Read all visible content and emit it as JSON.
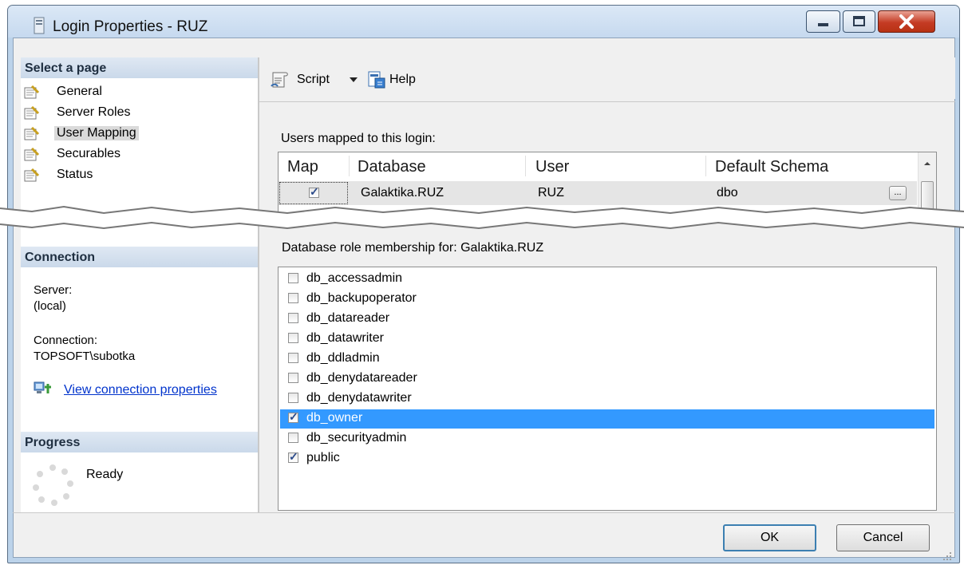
{
  "window": {
    "title": "Login Properties - RUZ"
  },
  "left": {
    "select_page_header": "Select a page",
    "pages": [
      {
        "label": "General",
        "selected": false
      },
      {
        "label": "Server Roles",
        "selected": false
      },
      {
        "label": "User Mapping",
        "selected": true
      },
      {
        "label": "Securables",
        "selected": false
      },
      {
        "label": "Status",
        "selected": false
      }
    ],
    "connection_header": "Connection",
    "server_label": "Server:",
    "server_value": "(local)",
    "connection_label": "Connection:",
    "connection_value": "TOPSOFT\\subotka",
    "view_connection_link": "View connection properties",
    "progress_header": "Progress",
    "progress_status": "Ready"
  },
  "toolbar": {
    "script_label": "Script",
    "help_label": "Help"
  },
  "users_mapped": {
    "caption": "Users mapped to this login:",
    "columns": [
      "Map",
      "Database",
      "User",
      "Default Schema"
    ],
    "rows": [
      {
        "map": true,
        "database": "Galaktika.RUZ",
        "user": "RUZ",
        "default_schema": "dbo",
        "browse": "..."
      }
    ]
  },
  "roles": {
    "caption": "Database role membership for: Galaktika.RUZ",
    "items": [
      {
        "label": "db_accessadmin",
        "checked": false,
        "selected": false
      },
      {
        "label": "db_backupoperator",
        "checked": false,
        "selected": false
      },
      {
        "label": "db_datareader",
        "checked": false,
        "selected": false
      },
      {
        "label": "db_datawriter",
        "checked": false,
        "selected": false
      },
      {
        "label": "db_ddladmin",
        "checked": false,
        "selected": false
      },
      {
        "label": "db_denydatareader",
        "checked": false,
        "selected": false
      },
      {
        "label": "db_denydatawriter",
        "checked": false,
        "selected": false
      },
      {
        "label": "db_owner",
        "checked": true,
        "selected": true
      },
      {
        "label": "db_securityadmin",
        "checked": false,
        "selected": false
      },
      {
        "label": "public",
        "checked": true,
        "selected": false
      }
    ]
  },
  "buttons": {
    "ok": "OK",
    "cancel": "Cancel"
  },
  "colors": {
    "selection": "#3399ff",
    "link": "#0033cc",
    "close_button": "#c43b24"
  }
}
